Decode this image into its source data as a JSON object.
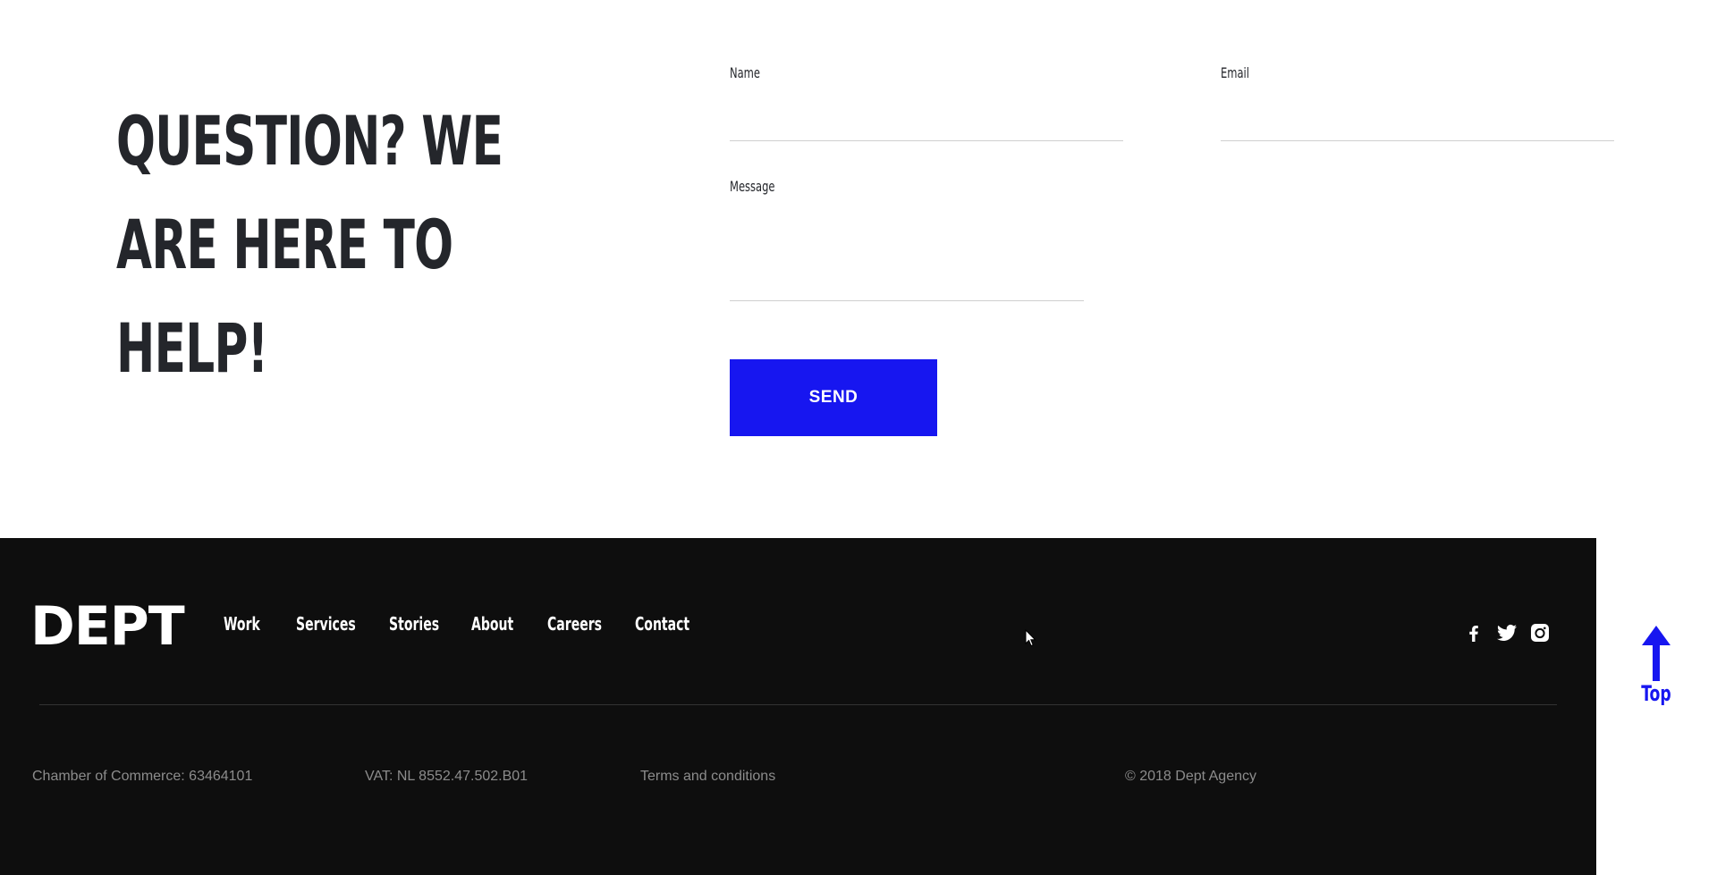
{
  "contact": {
    "headline_line1": "QUESTION? WE",
    "headline_line2": "ARE HERE TO",
    "headline_line3": "HELP!",
    "name_label": "Name",
    "name_value": "",
    "email_label": "Email",
    "email_value": "",
    "message_label": "Message",
    "message_value": "",
    "send_label": "SEND"
  },
  "footer": {
    "logo": "DEPT",
    "nav": [
      "Work",
      "Services",
      "Stories",
      "About",
      "Careers",
      "Contact"
    ],
    "social": [
      "facebook-icon",
      "twitter-icon",
      "instagram-icon"
    ],
    "legal": {
      "chamber": "Chamber of Commerce: 63464101",
      "vat": "VAT: NL 8552.47.502.B01",
      "terms": "Terms and conditions",
      "copyright": "© 2018 Dept Agency"
    }
  },
  "back_to_top": {
    "label": "Top"
  },
  "colors": {
    "accent": "#1716f0",
    "footer_bg": "#0e0e0e",
    "heading": "#24262b",
    "muted": "#8c8c8c"
  }
}
